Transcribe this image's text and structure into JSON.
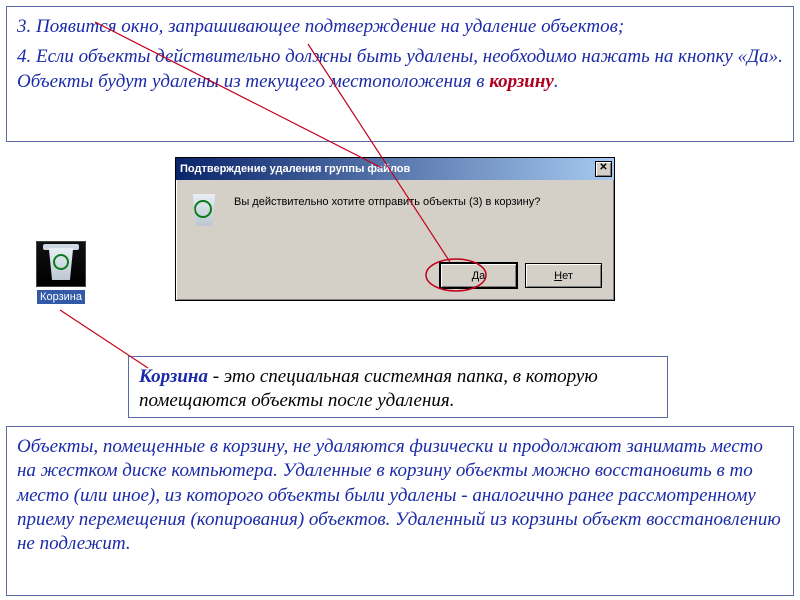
{
  "box1": {
    "step3": "3. Появится окно, запрашивающее подтверждение на удаление объектов;",
    "step4a": "4. Если объекты действительно должны быть удалены, необходимо нажать на кнопку «Да». Объекты будут удалены из текущего местоположения в ",
    "step4_korzinu": "корзину",
    "step4_dot": "."
  },
  "bin": {
    "label": "Корзина"
  },
  "dialog": {
    "title": "Подтверждение удаления группы файлов",
    "message": "Вы действительно хотите отправить объекты (3) в корзину?",
    "yes_u": "Д",
    "yes_rest": "а",
    "no_u": "Н",
    "no_rest": "ет",
    "close_x": "✕"
  },
  "def": {
    "korzina": "Корзина",
    "rest": " - это специальная системная папка, в которую помещаются объекты после удаления."
  },
  "footer": {
    "text": "Объекты, помещенные в корзину, не удаляются  физически и продолжают занимать место на жестком диске компьютера. Удаленные в корзину объекты можно восстановить в то место (или иное), из которого объекты были удалены - аналогично ранее рассмотренному приему перемещения (копирования) объектов. Удаленный из корзины объект восстановлению не подлежит."
  }
}
